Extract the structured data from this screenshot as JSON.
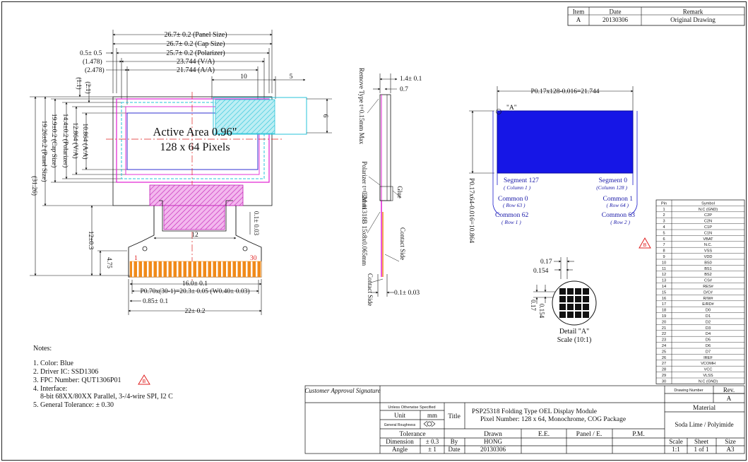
{
  "revision_table": {
    "headers": [
      "Item",
      "Date",
      "Remark"
    ],
    "row": [
      "A",
      "20130306",
      "Original Drawing"
    ]
  },
  "front_view": {
    "dims": {
      "panel_size": "26.7± 0.2 (Panel Size)",
      "cap_size": "26.7± 0.2 (Cap Size)",
      "polarizer": "25.7± 0.2 (Polarizer)",
      "va": "23.744 (V/A)",
      "aa": "21.744 (A/A)",
      "offset_05": "0.5± 0.5",
      "offset_1478": "(1.478)",
      "offset_2478": "(2.478)",
      "top_10": "10",
      "top_5": "5",
      "side_1_1": "(1.1)",
      "side_2_1": "(2.1)",
      "side_6": "6",
      "v_aa": "10.864 (A/A)",
      "v_va": "12.864 (V/A)",
      "v_pol": "14.4±0.2 (Polarizer)",
      "v_cap": "19.9±0.2 (Cap Size)",
      "v_panel": "19.26±0.2 (Panel Size)",
      "v_total": "(31.26)",
      "v_120": "12±0.3",
      "v_475": "4.75",
      "fpc_thk": "0.1± 0.03",
      "fpc_12": "12",
      "fpc_16": "16.0± 0.1",
      "pitch": "P0.70x(30-1)=20.3± 0.05 (W0.40± 0.03)",
      "pad_085": "0.85± 0.1",
      "fpc_22": "22± 0.2",
      "pin_first": "1",
      "pin_last": "30",
      "active_line1": "Active Area 0.96\"",
      "active_line2": "128 x 64 Pixels"
    }
  },
  "side_view": {
    "removal_tape": "Remove Type t=0.15mm Max",
    "d14": "1.4± 0.1",
    "d07": "0.7",
    "polarizer": "Polarizer t=0.2mm",
    "glue": "Glue",
    "tape": "3M #1318B 15x8x0.065mm",
    "contact_side": "Contact Side",
    "contact_side2": "Contact Side",
    "d01": "0.1± 0.03"
  },
  "pixel_diagram": {
    "top_dim": "P0.17x128-0.016=21.744",
    "side_dim": "P0.17x64-0.016=10.864",
    "label_a": "\"A\"",
    "seg127": "Segment 127",
    "col1": "( Column 1 )",
    "seg0": "Segment 0",
    "col128": "(Column 128 )",
    "com0": "Common 0",
    "row63": "( Row 63 )",
    "com1": "Common 1",
    "row64": "( Row 64 )",
    "com62": "Common 62",
    "row1": "( Row 1 )",
    "com63": "Common 63",
    "row2": "( Row 2 )",
    "d017": "0.17",
    "d0154": "0.154",
    "d017v": "0.17",
    "d0154v": "0.154",
    "detail_title": "Detail \"A\"",
    "detail_scale": "Scale (10:1)",
    "rev_badge": "B"
  },
  "pin_table": {
    "headers": [
      "Pin",
      "Symbol"
    ],
    "rows": [
      [
        "1",
        "N.C (GND)"
      ],
      [
        "2",
        "C2P"
      ],
      [
        "3",
        "C2N"
      ],
      [
        "4",
        "C1P"
      ],
      [
        "5",
        "C1N"
      ],
      [
        "6",
        "VBAT"
      ],
      [
        "7",
        "N.C."
      ],
      [
        "8",
        "VSS"
      ],
      [
        "9",
        "VDD"
      ],
      [
        "10",
        "BS0"
      ],
      [
        "11",
        "BS1"
      ],
      [
        "12",
        "BS2"
      ],
      [
        "13",
        "CS#"
      ],
      [
        "14",
        "RES#"
      ],
      [
        "15",
        "D/C#"
      ],
      [
        "16",
        "R/W#"
      ],
      [
        "17",
        "E/RD#"
      ],
      [
        "18",
        "D0"
      ],
      [
        "19",
        "D1"
      ],
      [
        "20",
        "D2"
      ],
      [
        "21",
        "D3"
      ],
      [
        "22",
        "D4"
      ],
      [
        "23",
        "D5"
      ],
      [
        "24",
        "D6"
      ],
      [
        "25",
        "D7"
      ],
      [
        "26",
        "IREF"
      ],
      [
        "27",
        "VCOMH"
      ],
      [
        "28",
        "VCC"
      ],
      [
        "29",
        "VLSS"
      ],
      [
        "30",
        "N.C (GND)"
      ]
    ]
  },
  "notes": {
    "title": "Notes:",
    "items": [
      "1. Color: Blue",
      "2. Driver IC: SSD1306",
      "3. FPC Number: QUT1306P01",
      "4. Interface:",
      "8-bit 68XX/80XX Parallel, 3-/4-wire SPI, I2 C",
      "5. General Tolerance: ± 0.30"
    ],
    "badge": "B"
  },
  "title_block": {
    "customer_approval": "Customer Approval Signature",
    "unless": "Unless Otherwise Specified",
    "unit_label": "Unit",
    "unit_value": "mm",
    "roughness": "General Roughness",
    "tolerance": "Tolerance",
    "dimension_label": "Dimension",
    "dimension_value": "± 0.3",
    "angle_label": "Angle",
    "angle_value": "± 1",
    "title_label": "Title",
    "title_line1": "PSP25318  Folding Type OEL Display Module",
    "title_line2": "Pixel Number: 128 x 64, Monochrome, COG Package",
    "drawn_label": "Drawn",
    "ee_label": "E.E.",
    "panel_label": "Panel / E.",
    "pm_label": "P.M.",
    "by_label": "By",
    "by_value": "HONG",
    "date_label": "Date",
    "date_value": "20130306",
    "drawing_number_label": "Drawing Number",
    "rev_label": "Rev.",
    "rev_value": "A",
    "material_label": "Material",
    "material_value": "Soda Lime / Polyimide",
    "scale_label": "Scale",
    "scale_value": "1:1",
    "sheet_label": "Sheet",
    "sheet_value": "1 of 1",
    "size_label": "Size",
    "size_value": "A3"
  },
  "colors": {
    "line": "#111111",
    "magenta": "#e11fd2",
    "cyan": "#27c3d8",
    "red_dash": "#e02020",
    "blue_panel": "#1616e6",
    "fpc_orange": "#f08a1a",
    "badge_red": "#e02020"
  }
}
